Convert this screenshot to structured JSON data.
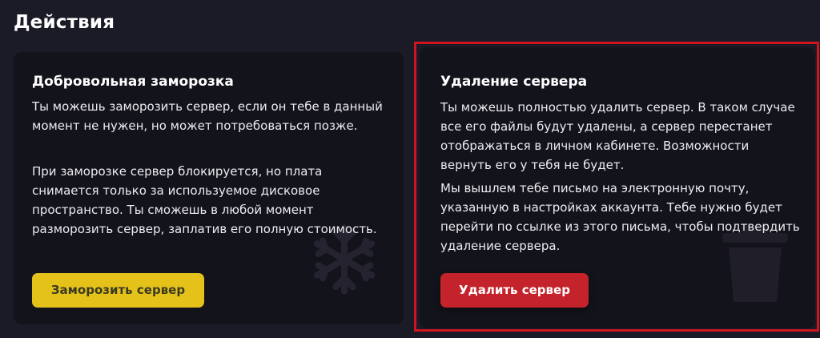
{
  "section": {
    "title": "Действия"
  },
  "freeze_card": {
    "title": "Добровольная заморозка",
    "paragraph1": "Ты можешь заморозить сервер, если он тебе в данный момент не нужен, но может потребоваться позже.",
    "paragraph2": "При заморозке сервер блокируется, но плата снимается только за используемое дисковое пространство. Ты сможешь в любой момент разморозить сервер, заплатив его полную стоимость.",
    "button_label": "Заморозить сервер",
    "background_icon": "snowflake-icon"
  },
  "delete_card": {
    "title": "Удаление сервера",
    "paragraph1": "Ты можешь полностью удалить сервер. В таком случае все его файлы будут удалены, а сервер перестанет отображаться в личном кабинете. Возможности вернуть его у тебя не будет.",
    "paragraph2": "Мы вышлем тебе письмо на электронную почту, указанную в настройках аккаунта. Тебе нужно будет перейти по ссылке из этого письма, чтобы подтвердить удаление сервера.",
    "button_label": "Удалить сервер",
    "background_icon": "trash-icon"
  },
  "colors": {
    "page_background": "#1a1b27",
    "card_background": "#13131b",
    "freeze_button": "#e5c21a",
    "delete_button": "#c4232b",
    "highlight_frame": "#d0151f"
  }
}
